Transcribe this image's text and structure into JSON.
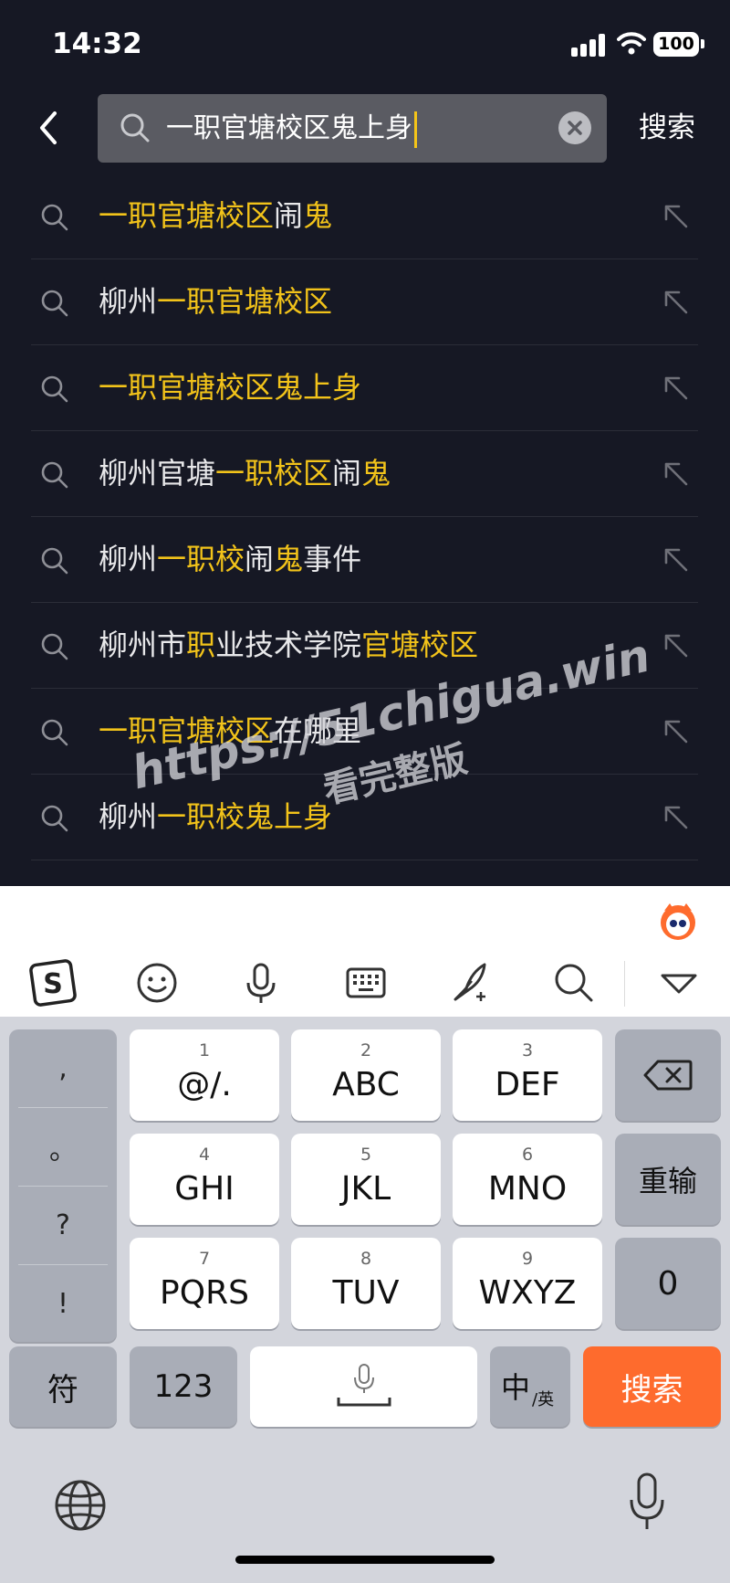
{
  "status_bar": {
    "time": "14:32",
    "battery": "100"
  },
  "search": {
    "query": "一职官塘校区鬼上身",
    "action_label": "搜索"
  },
  "suggestions": [
    {
      "parts": [
        {
          "t": "一职官塘校区",
          "h": true
        },
        {
          "t": "闹",
          "h": false
        },
        {
          "t": "鬼",
          "h": true
        }
      ]
    },
    {
      "parts": [
        {
          "t": "柳州",
          "h": false
        },
        {
          "t": "一职官塘校区",
          "h": true
        }
      ]
    },
    {
      "parts": [
        {
          "t": "一职官塘校区鬼上身",
          "h": true
        }
      ]
    },
    {
      "parts": [
        {
          "t": "柳州官塘",
          "h": false
        },
        {
          "t": "一职校区",
          "h": true
        },
        {
          "t": "闹",
          "h": false
        },
        {
          "t": "鬼",
          "h": true
        }
      ]
    },
    {
      "parts": [
        {
          "t": "柳州",
          "h": false
        },
        {
          "t": "一职校",
          "h": true
        },
        {
          "t": "闹",
          "h": false
        },
        {
          "t": "鬼",
          "h": true
        },
        {
          "t": "事件",
          "h": false
        }
      ]
    },
    {
      "parts": [
        {
          "t": "柳州市",
          "h": false
        },
        {
          "t": "职",
          "h": true
        },
        {
          "t": "业技术学院",
          "h": false
        },
        {
          "t": "官塘校区",
          "h": true
        }
      ]
    },
    {
      "parts": [
        {
          "t": "一职官塘校区",
          "h": true
        },
        {
          "t": "在哪里",
          "h": false
        }
      ]
    },
    {
      "parts": [
        {
          "t": "柳州",
          "h": false
        },
        {
          "t": "一职校鬼上身",
          "h": true
        }
      ]
    }
  ],
  "watermark": {
    "line1": "https://51chigua.win",
    "line2": "看完整版"
  },
  "keyboard": {
    "toolbar_icons": [
      "sogou-logo-icon",
      "emoji-icon",
      "microphone-icon",
      "keyboard-icon",
      "handwriting-icon",
      "search-icon",
      "collapse-icon"
    ],
    "punctuation": [
      ",",
      "。",
      "?",
      "!"
    ],
    "keys": [
      {
        "num": "1",
        "label": "@/."
      },
      {
        "num": "2",
        "label": "ABC"
      },
      {
        "num": "3",
        "label": "DEF"
      },
      {
        "num": "4",
        "label": "GHI"
      },
      {
        "num": "5",
        "label": "JKL"
      },
      {
        "num": "6",
        "label": "MNO"
      },
      {
        "num": "7",
        "label": "PQRS"
      },
      {
        "num": "8",
        "label": "TUV"
      },
      {
        "num": "9",
        "label": "WXYZ"
      }
    ],
    "reenter_label": "重输",
    "zero_label": "0",
    "symbols_label": "符",
    "numbers_label": "123",
    "lang_label_main": "中",
    "lang_label_sub": "/英",
    "search_label": "搜索"
  },
  "colors": {
    "background": "#161824",
    "highlight": "#f2c31a",
    "search_key": "#fe6b2d"
  }
}
